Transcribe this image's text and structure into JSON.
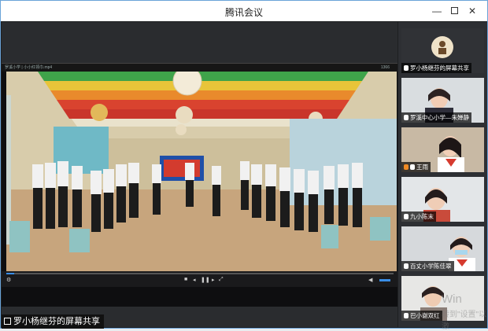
{
  "window": {
    "title": "腾讯会议"
  },
  "player": {
    "file_name": "罗溪小学 | 小小红领巾.mp4",
    "duration": "1366",
    "progress_fraction": 0.02
  },
  "share": {
    "label": "罗小杨继芬的屏幕共享"
  },
  "participants": [
    {
      "name": "罗小杨继芬的屏幕共享",
      "kind": "screen-share"
    },
    {
      "name": "罗溪中心小学—朱婵静"
    },
    {
      "name": "王雨",
      "alert": true
    },
    {
      "name": "九小陈末"
    },
    {
      "name": "百丈小学陈佳翠"
    },
    {
      "name": "巴小谢双红"
    }
  ],
  "watermark": {
    "line1": "Win",
    "line2": "转到\"设置\"以激"
  },
  "colors": {
    "accent": "#3a8ee6",
    "alert": "#f08a24"
  },
  "icons": [
    "minimize-icon",
    "maximize-icon",
    "close-icon",
    "mic-icon",
    "play-icon",
    "pause-icon",
    "fullscreen-icon",
    "volume-icon",
    "screen-share-icon"
  ]
}
